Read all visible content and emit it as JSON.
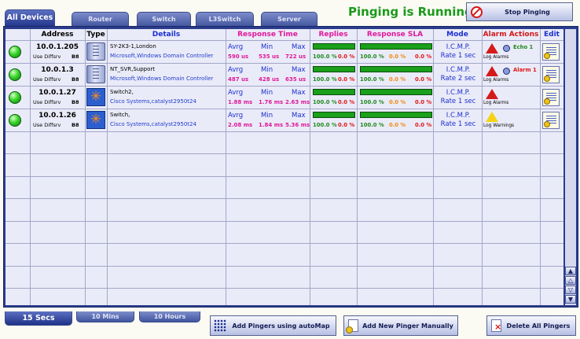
{
  "tabs": [
    {
      "label": "All Devices",
      "active": true
    },
    {
      "label": "Router",
      "active": false
    },
    {
      "label": "Switch",
      "active": false
    },
    {
      "label": "L3Switch",
      "active": false
    },
    {
      "label": "Server",
      "active": false
    }
  ],
  "status_text": "Pinging is Running",
  "stop_button": "Stop Pinging",
  "columns": {
    "address": "Address",
    "type": "Type",
    "details": "Details",
    "response_time": "Response Time",
    "replies": "Replies",
    "response_sla": "Response SLA",
    "mode": "Mode",
    "alarm_actions": "Alarm Actions",
    "edit": "Edit"
  },
  "rt_labels": {
    "avg": "Avrg",
    "min": "Min",
    "max": "Max"
  },
  "use_diffsrv_label": "Use Diffsrv",
  "colors": {
    "status_green": "#1a9a1a",
    "response_pink": "#e0189a",
    "pct_green": "#1e8a1e",
    "pct_red": "#e01818",
    "pct_orange": "#f08a10",
    "link_blue": "#1a2fd0"
  },
  "rows": [
    {
      "status": "up",
      "address": "10.0.1.205",
      "dscp": "B8",
      "type_icon": "server-icon",
      "details_line1": "SY-2K3-1,London",
      "details_line2": "Microsoft,Windows Domain Controller",
      "rt": {
        "avg": "590 us",
        "min": "535 us",
        "max": "722 us"
      },
      "replies": {
        "pass": "100.0 %",
        "fail": "0.0 %",
        "bar_fraction": 1.0
      },
      "sla": {
        "ok": "100.0 %",
        "warn": "0.0 %",
        "fail": "0.0 %",
        "bar_fraction": 1.0
      },
      "mode_protocol": "I.C.M.P.",
      "mode_rate": "Rate 1 sec",
      "alarm_icon": "alarm-triangle-icon",
      "alarm_type": "Log Alarms",
      "alarm_extra": "Echo 1",
      "alarm_extra_color": "#1e8a1e"
    },
    {
      "status": "up",
      "address": "10.0.1.3",
      "dscp": "B8",
      "type_icon": "server-icon",
      "details_line1": "NT_SVR,Support",
      "details_line2": "Microsoft,Windows Domain Controller",
      "rt": {
        "avg": "487 us",
        "min": "428 us",
        "max": "635 us"
      },
      "replies": {
        "pass": "100.0 %",
        "fail": "0.0 %",
        "bar_fraction": 1.0
      },
      "sla": {
        "ok": "100.0 %",
        "warn": "0.0 %",
        "fail": "0.0 %",
        "bar_fraction": 1.0
      },
      "mode_protocol": "I.C.M.P.",
      "mode_rate": "Rate 2 sec",
      "alarm_icon": "alarm-triangle-icon",
      "alarm_type": "Log Alarms",
      "alarm_extra": "Alarm 1",
      "alarm_extra_color": "#e01818"
    },
    {
      "status": "up",
      "address": "10.0.1.27",
      "dscp": "B8",
      "type_icon": "switch-icon",
      "details_line1": "Switch2,",
      "details_line2": "Cisco Systems,catalyst2950t24",
      "rt": {
        "avg": "1.88 ms",
        "min": "1.76 ms",
        "max": "2.63 ms"
      },
      "replies": {
        "pass": "100.0 %",
        "fail": "0.0 %",
        "bar_fraction": 1.0
      },
      "sla": {
        "ok": "100.0 %",
        "warn": "0.0 %",
        "fail": "0.0 %",
        "bar_fraction": 1.0
      },
      "mode_protocol": "I.C.M.P.",
      "mode_rate": "Rate 1 sec",
      "alarm_icon": "alarm-triangle-icon",
      "alarm_type": "Log Alarms",
      "alarm_extra": "",
      "alarm_extra_color": "#000000"
    },
    {
      "status": "up",
      "address": "10.0.1.26",
      "dscp": "B8",
      "type_icon": "switch-icon",
      "details_line1": "Switch,",
      "details_line2": "Cisco Systems,catalyst2950t24",
      "rt": {
        "avg": "2.08 ms",
        "min": "1.84 ms",
        "max": "5.36 ms"
      },
      "replies": {
        "pass": "100.0 %",
        "fail": "0.0 %",
        "bar_fraction": 1.0
      },
      "sla": {
        "ok": "100.0 %",
        "warn": "0.0 %",
        "fail": "0.0 %",
        "bar_fraction": 1.0
      },
      "mode_protocol": "I.C.M.P.",
      "mode_rate": "Rate 1 sec",
      "alarm_icon": "warning-triangle-icon",
      "alarm_type": "Log Warnings",
      "alarm_extra": "",
      "alarm_extra_color": "#000000"
    }
  ],
  "time_tabs": [
    {
      "label": "15 Secs",
      "active": true
    },
    {
      "label": "10 Mins",
      "active": false
    },
    {
      "label": "10 Hours",
      "active": false
    }
  ],
  "bottom_buttons": {
    "automap": "Add Pingers using autoMap",
    "add_manual": "Add New Pinger Manually",
    "delete_all": "Delete All Pingers"
  }
}
